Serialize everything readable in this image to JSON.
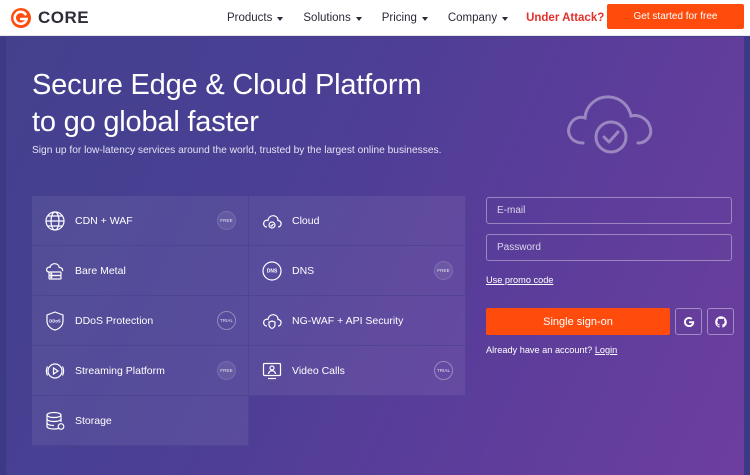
{
  "header": {
    "logo_text": "CORE",
    "nav": [
      {
        "label": "Products"
      },
      {
        "label": "Solutions"
      },
      {
        "label": "Pricing"
      },
      {
        "label": "Company"
      }
    ],
    "under_attack": "Under Attack?",
    "cta_label": "Get started for free"
  },
  "hero": {
    "title_line1": "Secure Edge & Cloud Platform",
    "title_line2": "to go global faster",
    "subtitle": "Sign up for low-latency services around the world, trusted by the largest online businesses."
  },
  "products": [
    {
      "label": "CDN + WAF",
      "icon": "globe-icon",
      "badge": "FREE"
    },
    {
      "label": "Cloud",
      "icon": "cloud-icon",
      "badge": ""
    },
    {
      "label": "Bare Metal",
      "icon": "bare-metal-icon",
      "badge": ""
    },
    {
      "label": "DNS",
      "icon": "dns-icon",
      "badge": "FREE"
    },
    {
      "label": "DDoS Protection",
      "icon": "ddos-shield-icon",
      "badge": "TRIAL"
    },
    {
      "label": "NG-WAF + API Security",
      "icon": "cloud-shield-icon",
      "badge": ""
    },
    {
      "label": "Streaming Platform",
      "icon": "play-icon",
      "badge": "FREE"
    },
    {
      "label": "Video Calls",
      "icon": "video-calls-icon",
      "badge": "TRIAL"
    },
    {
      "label": "Storage",
      "icon": "storage-icon",
      "badge": ""
    }
  ],
  "form": {
    "email_placeholder": "E-mail",
    "password_placeholder": "Password",
    "promo_link": "Use promo code",
    "sso_label": "Single sign-on",
    "account_text": "Already have an account?",
    "login_link": "Login"
  },
  "colors": {
    "accent": "#ff4c0d",
    "danger": "#e4302b",
    "hero_bg": "#4a3f94"
  }
}
